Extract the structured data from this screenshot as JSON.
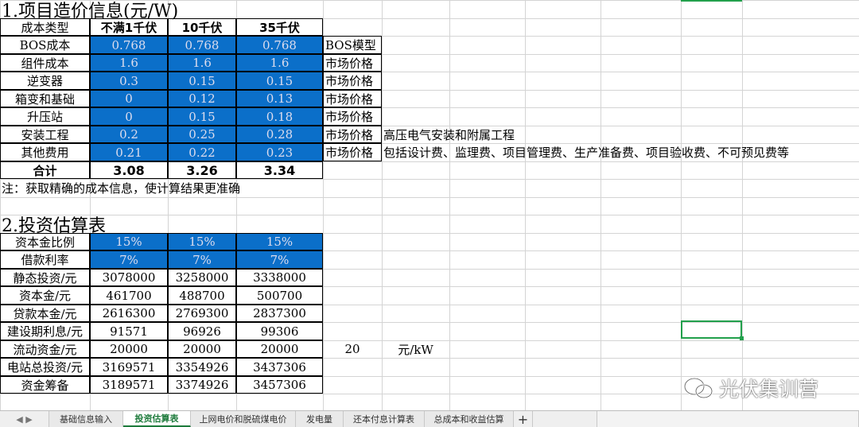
{
  "section1": {
    "title": "1.项目造价信息(元/W)",
    "header": {
      "label": "成本类型",
      "cols": [
        "不满1千伏",
        "10千伏",
        "35千伏"
      ]
    },
    "rows": [
      {
        "label": "BOS成本",
        "values": [
          "0.768",
          "0.768",
          "0.768"
        ],
        "note": "BOS模型",
        "extra": ""
      },
      {
        "label": "组件成本",
        "values": [
          "1.6",
          "1.6",
          "1.6"
        ],
        "note": "市场价格",
        "extra": ""
      },
      {
        "label": "逆变器",
        "values": [
          "0.3",
          "0.15",
          "0.15"
        ],
        "note": "市场价格",
        "extra": ""
      },
      {
        "label": "箱变和基础",
        "values": [
          "0",
          "0.12",
          "0.13"
        ],
        "note": "市场价格",
        "extra": ""
      },
      {
        "label": "升压站",
        "values": [
          "0",
          "0.15",
          "0.18"
        ],
        "note": "市场价格",
        "extra": ""
      },
      {
        "label": "安装工程",
        "values": [
          "0.2",
          "0.25",
          "0.28"
        ],
        "note": "市场价格",
        "extra": "高压电气安装和附属工程"
      },
      {
        "label": "其他费用",
        "values": [
          "0.21",
          "0.22",
          "0.23"
        ],
        "note": "市场价格",
        "extra": "包括设计费、监理费、项目管理费、生产准备费、项目验收费、不可预见费等"
      }
    ],
    "total": {
      "label": "合计",
      "values": [
        "3.08",
        "3.26",
        "3.34"
      ]
    },
    "footnote": "注：获取精确的成本信息，使计算结果更准确"
  },
  "section2": {
    "title": "2.投资估算表",
    "rows": [
      {
        "label": "资本金比例",
        "values": [
          "15%",
          "15%",
          "15%"
        ],
        "blue": true
      },
      {
        "label": "借款利率",
        "values": [
          "7%",
          "7%",
          "7%"
        ],
        "blue": true
      },
      {
        "label": "静态投资/元",
        "values": [
          "3078000",
          "3258000",
          "3338000"
        ],
        "blue": false
      },
      {
        "label": "资本金/元",
        "values": [
          "461700",
          "488700",
          "500700"
        ],
        "blue": false
      },
      {
        "label": "贷款本金/元",
        "values": [
          "2616300",
          "2769300",
          "2837300"
        ],
        "blue": false
      },
      {
        "label": "建设期利息/元",
        "values": [
          "91571",
          "96926",
          "99306"
        ],
        "blue": false
      },
      {
        "label": "流动资金/元",
        "values": [
          "20000",
          "20000",
          "20000"
        ],
        "blue": false
      },
      {
        "label": "电站总投资/元",
        "values": [
          "3169571",
          "3354926",
          "3437306"
        ],
        "blue": false
      },
      {
        "label": "资金筹备",
        "values": [
          "3189571",
          "3374926",
          "3457306"
        ],
        "blue": false
      }
    ],
    "side_value": "20",
    "side_unit": "元/kW"
  },
  "watermark": "光伏集训营",
  "tabs": [
    {
      "label": "基础信息输入",
      "active": false
    },
    {
      "label": "投资估算表",
      "active": true
    },
    {
      "label": "上网电价和脱硫煤电价",
      "active": false
    },
    {
      "label": "发电量",
      "active": false
    },
    {
      "label": "还本付息计算表",
      "active": false
    },
    {
      "label": "总成本和收益估算",
      "active": false
    }
  ],
  "add_tab_symbol": "+",
  "colors": {
    "blue_fill": "#0b6fc9",
    "grid_line": "#d4d4d4",
    "selection": "#22a04c"
  }
}
